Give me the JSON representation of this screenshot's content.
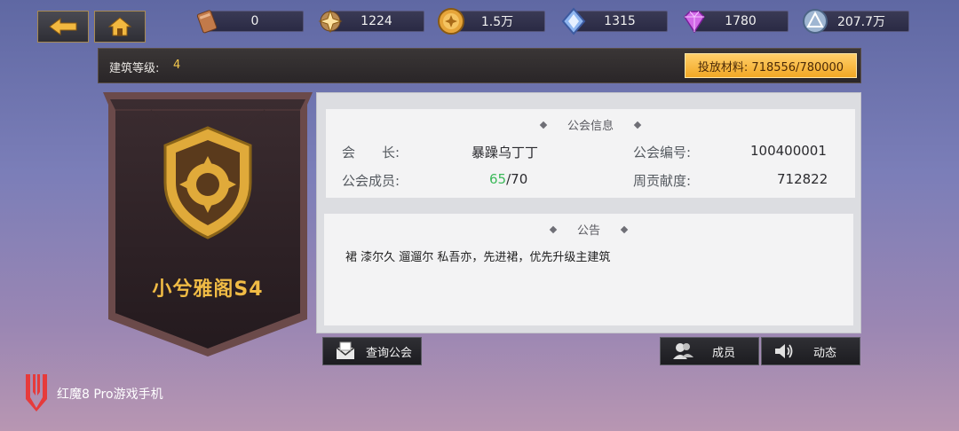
{
  "nav": {
    "back_icon": "arrow-left-icon",
    "home_icon": "home-icon"
  },
  "resources": [
    {
      "icon": "scroll-icon",
      "value": "0"
    },
    {
      "icon": "star-emblem-icon",
      "value": "1224"
    },
    {
      "icon": "gold-coin-icon",
      "value": "1.5万"
    },
    {
      "icon": "blue-crystal-icon",
      "value": "1315"
    },
    {
      "icon": "purple-diamond-icon",
      "value": "1780"
    },
    {
      "icon": "silver-orb-icon",
      "value": "207.7万"
    }
  ],
  "level": {
    "label": "建筑等级:",
    "value": "4"
  },
  "invest": {
    "label": "投放材料: 718556/780000"
  },
  "guild": {
    "name": "小兮雅阁S4",
    "emblem_icon": "guild-shield-emblem-icon"
  },
  "info": {
    "title": "公会信息",
    "leader_label": "会　　长:",
    "leader_value": "暴躁乌丁丁",
    "id_label": "公会编号:",
    "id_value": "100400001",
    "members_label": "公会成员:",
    "members_current": "65",
    "members_max": "/70",
    "contrib_label": "周贡献度:",
    "contrib_value": "712822"
  },
  "notice": {
    "title": "公告",
    "text": "裙 漆尔久 遛遛尔 私吾亦，先进裙，优先升级主建筑"
  },
  "buttons": {
    "query": "查询公会",
    "members": "成员",
    "activity": "动态"
  },
  "watermark": {
    "text": "红魔8 Pro游戏手机"
  },
  "colors": {
    "accent_gold": "#f4c84d",
    "member_green": "#3cb95a",
    "invest_orange": "#f2a825"
  }
}
